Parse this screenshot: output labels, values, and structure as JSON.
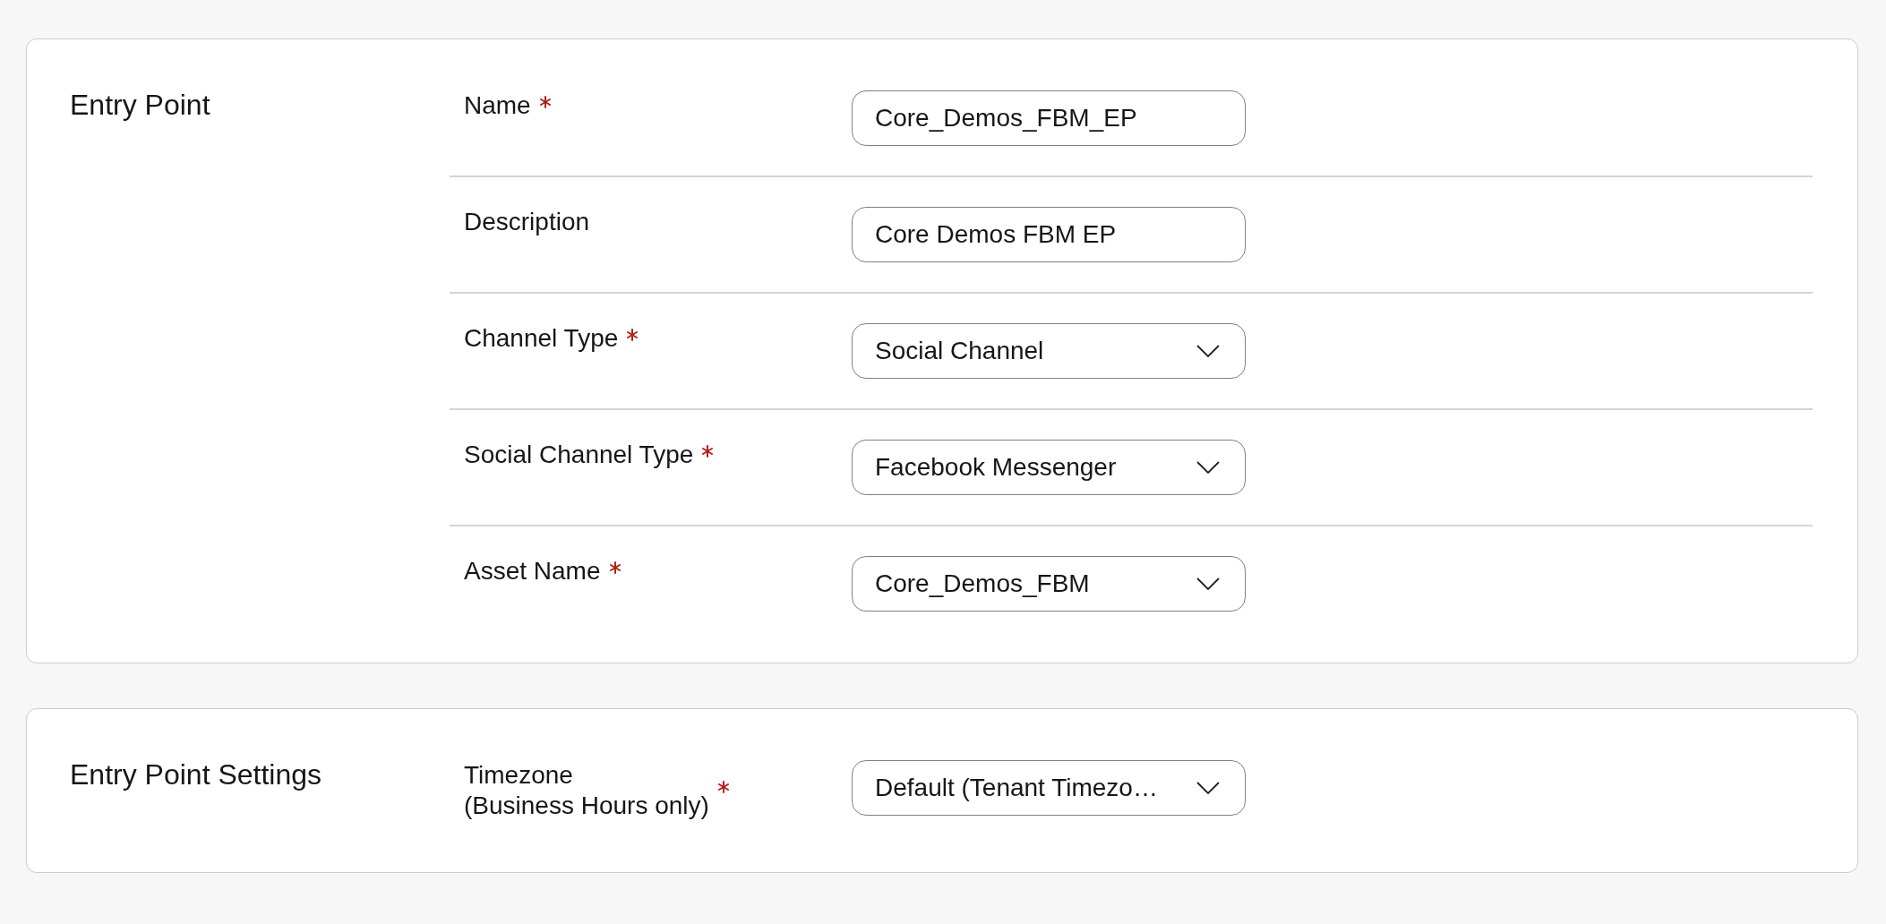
{
  "sections": [
    {
      "title": "Entry Point",
      "fields": [
        {
          "label": "Name",
          "required": true,
          "kind": "text",
          "value": "Core_Demos_FBM_EP"
        },
        {
          "label": "Description",
          "required": false,
          "kind": "text",
          "value": "Core Demos FBM EP"
        },
        {
          "label": "Channel Type",
          "required": true,
          "kind": "select",
          "value": "Social Channel"
        },
        {
          "label": "Social Channel Type",
          "required": true,
          "kind": "select",
          "value": "Facebook Messenger"
        },
        {
          "label": "Asset Name",
          "required": true,
          "kind": "select",
          "value": "Core_Demos_FBM"
        }
      ]
    },
    {
      "title": "Entry Point Settings",
      "fields": [
        {
          "label": "Timezone\n(Business Hours only)",
          "required": true,
          "kind": "select",
          "value": "Default (Tenant Timezo…"
        }
      ]
    }
  ]
}
